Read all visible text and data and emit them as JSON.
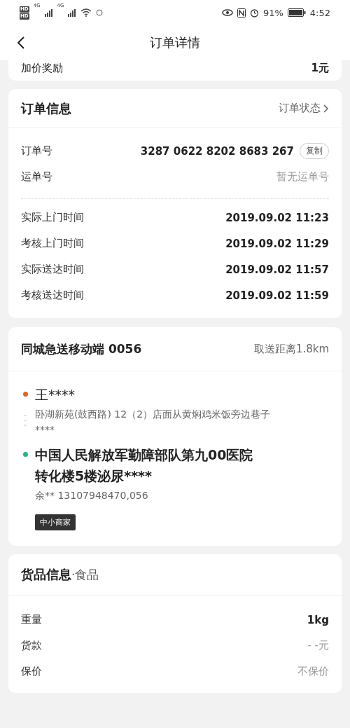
{
  "status_bar": {
    "sim_labels": [
      "HD",
      "HD"
    ],
    "network_labels": [
      "4G",
      "4G"
    ],
    "battery": "91%",
    "time": "4:52"
  },
  "nav": {
    "title": "订单详情"
  },
  "bonus": {
    "label": "加价奖励",
    "value": "1元"
  },
  "order_info": {
    "title": "订单信息",
    "link": "订单状态",
    "ids": [
      {
        "label": "订单号",
        "value": "3287 0622 8202 8683 267",
        "muted": false,
        "action": "复制"
      },
      {
        "label": "运单号",
        "value": "暂无运单号",
        "muted": true
      }
    ],
    "times": [
      {
        "label": "实际上门时间",
        "value": "2019.09.02 11:23"
      },
      {
        "label": "考核上门时间",
        "value": "2019.09.02 11:29"
      },
      {
        "label": "实际送达时间",
        "value": "2019.09.02 11:57"
      },
      {
        "label": "考核送达时间",
        "value": "2019.09.02 11:59"
      }
    ]
  },
  "delivery": {
    "title": "同城急送移动端 0056",
    "distance": "取送距离1.8km",
    "stops": [
      {
        "name": "王****",
        "detail": "卧湖新苑(鼓西路) 12（2）店面从黄焖鸡米饭旁边巷子****",
        "color": "#e0622c"
      },
      {
        "name": "中国人民解放军勤障部队第九00医院转化楼5楼泌尿****",
        "detail": "余** 13107948470,056",
        "color": "#23b48c"
      }
    ],
    "tag": "中小商家"
  },
  "goods": {
    "title": "货品信息",
    "category": "·食品",
    "rows": [
      {
        "label": "重量",
        "value": "1kg",
        "bold": true
      },
      {
        "label": "货款",
        "value": "- -元",
        "bold": false
      },
      {
        "label": "保价",
        "value": "不保价",
        "bold": false
      }
    ]
  }
}
